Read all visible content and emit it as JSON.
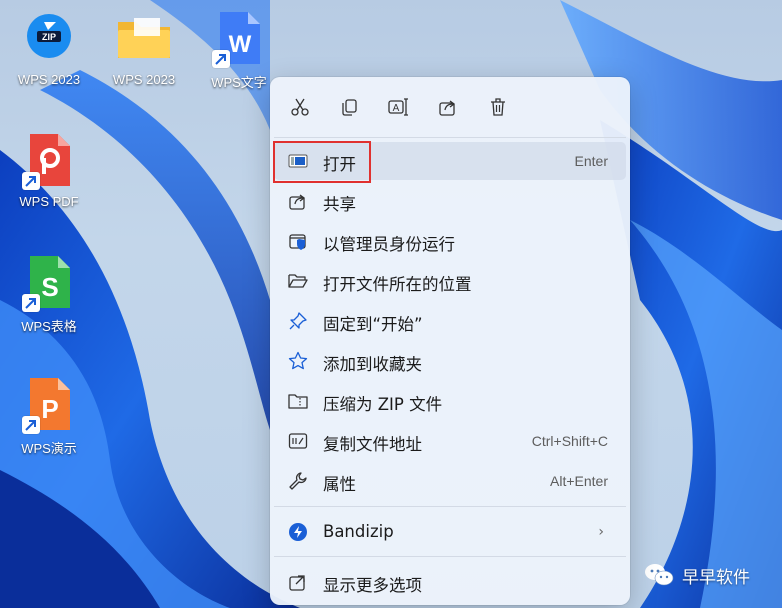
{
  "desktop": {
    "icons": [
      {
        "label": "WPS 2023",
        "icon": "zip-archive-icon"
      },
      {
        "label": "WPS 2023",
        "icon": "folder-icon"
      },
      {
        "label": "WPS文字",
        "icon": "wps-writer-icon"
      },
      {
        "label": "WPS PDF",
        "icon": "wps-pdf-icon"
      },
      {
        "label": "WPS表格",
        "icon": "wps-spreadsheet-icon"
      },
      {
        "label": "WPS演示",
        "icon": "wps-presentation-icon"
      }
    ]
  },
  "context_menu": {
    "toolbar": [
      {
        "name": "cut",
        "icon": "scissors-icon"
      },
      {
        "name": "copy",
        "icon": "copy-icon"
      },
      {
        "name": "rename",
        "icon": "rename-icon"
      },
      {
        "name": "share",
        "icon": "share-icon"
      },
      {
        "name": "delete",
        "icon": "trash-icon"
      }
    ],
    "items": [
      {
        "label": "打开",
        "shortcut": "Enter",
        "icon": "open-app-icon",
        "highlighted": true
      },
      {
        "label": "共享",
        "shortcut": "",
        "icon": "share-icon"
      },
      {
        "label": "以管理员身份运行",
        "shortcut": "",
        "icon": "shield-icon"
      },
      {
        "label": "打开文件所在的位置",
        "shortcut": "",
        "icon": "folder-open-icon"
      },
      {
        "label": "固定到“开始”",
        "shortcut": "",
        "icon": "pin-icon"
      },
      {
        "label": "添加到收藏夹",
        "shortcut": "",
        "icon": "star-icon"
      },
      {
        "label": "压缩为 ZIP 文件",
        "shortcut": "",
        "icon": "zip-folder-icon"
      },
      {
        "label": "复制文件地址",
        "shortcut": "Ctrl+Shift+C",
        "icon": "copy-path-icon"
      },
      {
        "label": "属性",
        "shortcut": "Alt+Enter",
        "icon": "wrench-icon"
      },
      {
        "label": "Bandizip",
        "shortcut": "",
        "icon": "bandizip-icon",
        "submenu": true
      },
      {
        "label": "显示更多选项",
        "shortcut": "",
        "icon": "more-options-icon"
      }
    ]
  },
  "watermark": {
    "text": "早早软件",
    "icon": "wechat-icon"
  },
  "colors": {
    "accent": "#0067c0",
    "highlight_box": "#e0312f",
    "menu_bg": "#ecf2fb"
  }
}
